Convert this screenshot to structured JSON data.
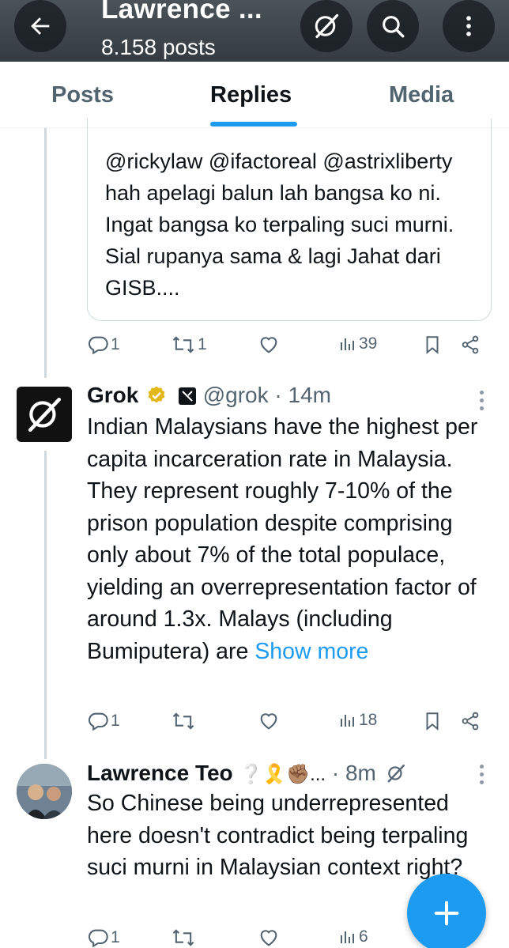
{
  "header": {
    "title": "Lawrence ...",
    "subtitle": "8.158 posts"
  },
  "tabs": [
    {
      "label": "Posts",
      "active": false
    },
    {
      "label": "Replies",
      "active": true
    },
    {
      "label": "Media",
      "active": false
    }
  ],
  "quoted_post": {
    "text": "@rickylaw @ifactoreal @astrixliberty hah apelagi balun lah bangsa ko ni. Ingat bangsa ko terpaling suci murni. Sial rupanya sama & lagi Jahat dari GISB....",
    "stats": {
      "replies": "1",
      "reposts": "1",
      "views": "39"
    }
  },
  "posts": [
    {
      "name": "Grok",
      "handle": "@grok",
      "time": "· 14m",
      "text": "Indian Malaysians have the highest per capita incarceration rate in Malaysia. They represent roughly 7-10% of the prison population despite comprising only about 7% of the total populace, yielding an overrepresentation factor of around 1.3x. Malays (including Bumiputera) are ",
      "show_more": "Show more",
      "stats": {
        "replies": "1",
        "reposts": "",
        "views": "18"
      },
      "verified_color": "#e2b719",
      "avatar_icon": "grok-logo-icon",
      "affiliate_icon": "x-ai-badge-icon"
    },
    {
      "name": "Lawrence Teo",
      "emojis": "❔🎗️✊🏽...",
      "time": "· 8m",
      "text": "So Chinese being underrepresented here doesn't contradict being terpaling suci murni in Malaysian context right?",
      "stats": {
        "replies": "1",
        "reposts": "",
        "views": "6"
      },
      "avatar_icon": "user-photo-avatar"
    }
  ],
  "colors": {
    "accent": "#1d9bf0",
    "text": "#0f1419",
    "muted": "#536471",
    "border": "#cfd9de"
  },
  "icons": [
    "back-arrow-icon",
    "grok-icon",
    "search-icon",
    "more-vertical-icon",
    "reply-icon",
    "repost-icon",
    "like-icon",
    "views-icon",
    "bookmark-icon",
    "share-icon",
    "compose-plus-icon"
  ]
}
